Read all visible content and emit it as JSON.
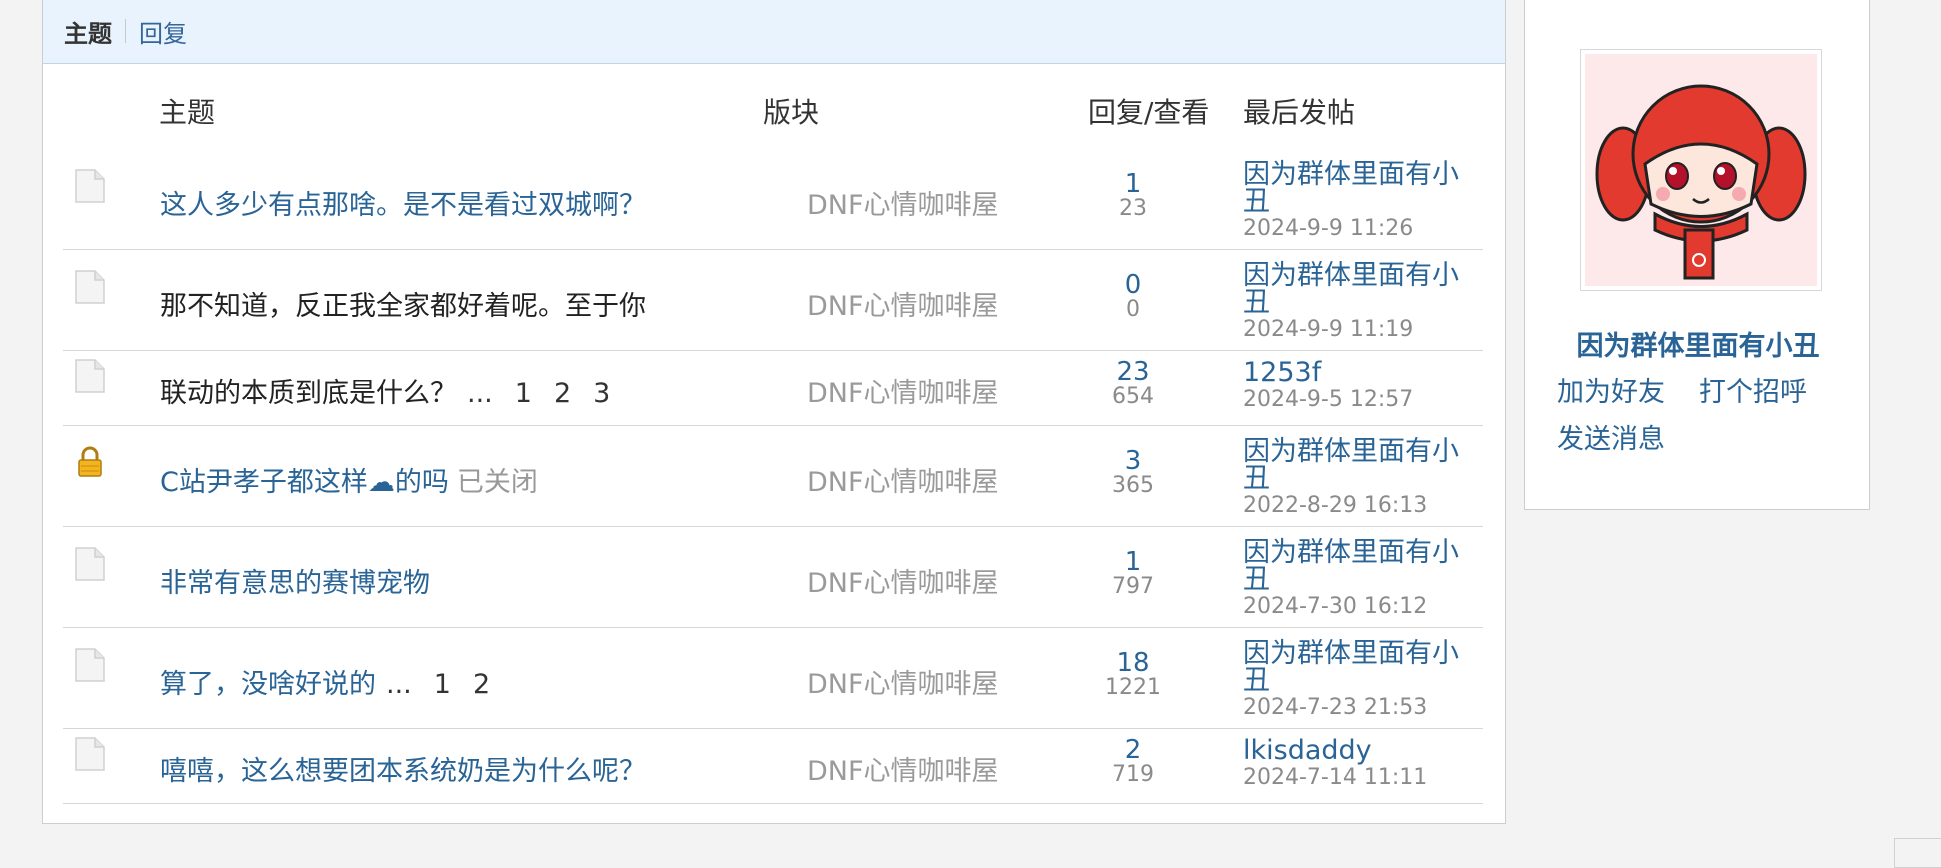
{
  "tabs": {
    "active": "主题",
    "other": "回复"
  },
  "columns": {
    "topic": "主题",
    "forum": "版块",
    "replies_views": "回复/查看",
    "last_post": "最后发帖"
  },
  "rows": [
    {
      "icon": "folder-icon",
      "title": "这人多少有点那啥。是不是看过双城啊？",
      "title_linked": true,
      "pages": [],
      "closed": "",
      "forum": "DNF心情咖啡屋",
      "replies": "1",
      "views": "23",
      "last_author": "因为群体里面有小丑",
      "last_date": "2024-9-9 11:26"
    },
    {
      "icon": "folder-icon",
      "title": "那不知道，反正我全家都好着呢。至于你",
      "title_linked": false,
      "pages": [],
      "closed": "",
      "forum": "DNF心情咖啡屋",
      "replies": "0",
      "views": "0",
      "last_author": "因为群体里面有小丑",
      "last_date": "2024-9-9 11:19"
    },
    {
      "icon": "folder-icon",
      "title": "联动的本质到底是什么？",
      "title_linked": false,
      "pages": [
        "...",
        "1",
        "2",
        "3"
      ],
      "closed": "",
      "forum": "DNF心情咖啡屋",
      "replies": "23",
      "views": "654",
      "last_author": "1253f",
      "last_date": "2024-9-5 12:57"
    },
    {
      "icon": "lock-icon",
      "title": "C站尹孝子都这样☁的吗",
      "title_linked": true,
      "pages": [],
      "closed": "已关闭",
      "forum": "DNF心情咖啡屋",
      "replies": "3",
      "views": "365",
      "last_author": "因为群体里面有小丑",
      "last_date": "2022-8-29 16:13"
    },
    {
      "icon": "folder-icon",
      "title": "非常有意思的赛博宠物",
      "title_linked": true,
      "pages": [],
      "closed": "",
      "forum": "DNF心情咖啡屋",
      "replies": "1",
      "views": "797",
      "last_author": "因为群体里面有小丑",
      "last_date": "2024-7-30 16:12"
    },
    {
      "icon": "folder-icon",
      "title": "算了，没啥好说的",
      "title_linked": true,
      "pages": [
        "...",
        "1",
        "2"
      ],
      "closed": "",
      "forum": "DNF心情咖啡屋",
      "replies": "18",
      "views": "1221",
      "last_author": "因为群体里面有小丑",
      "last_date": "2024-7-23 21:53"
    },
    {
      "icon": "folder-icon",
      "title": "嘻嘻，这么想要团本系统奶是为什么呢？",
      "title_linked": true,
      "pages": [],
      "closed": "",
      "forum": "DNF心情咖啡屋",
      "replies": "2",
      "views": "719",
      "last_author": "lkisdaddy",
      "last_date": "2024-7-14 11:11"
    }
  ],
  "profile": {
    "name": "因为群体里面有小丑",
    "add_friend": "加为好友",
    "greet": "打个招呼",
    "message": "发送消息"
  },
  "colors": {
    "link": "#2a6496",
    "tab_bg": "#e8f3fd",
    "muted": "#9a9a9a"
  }
}
